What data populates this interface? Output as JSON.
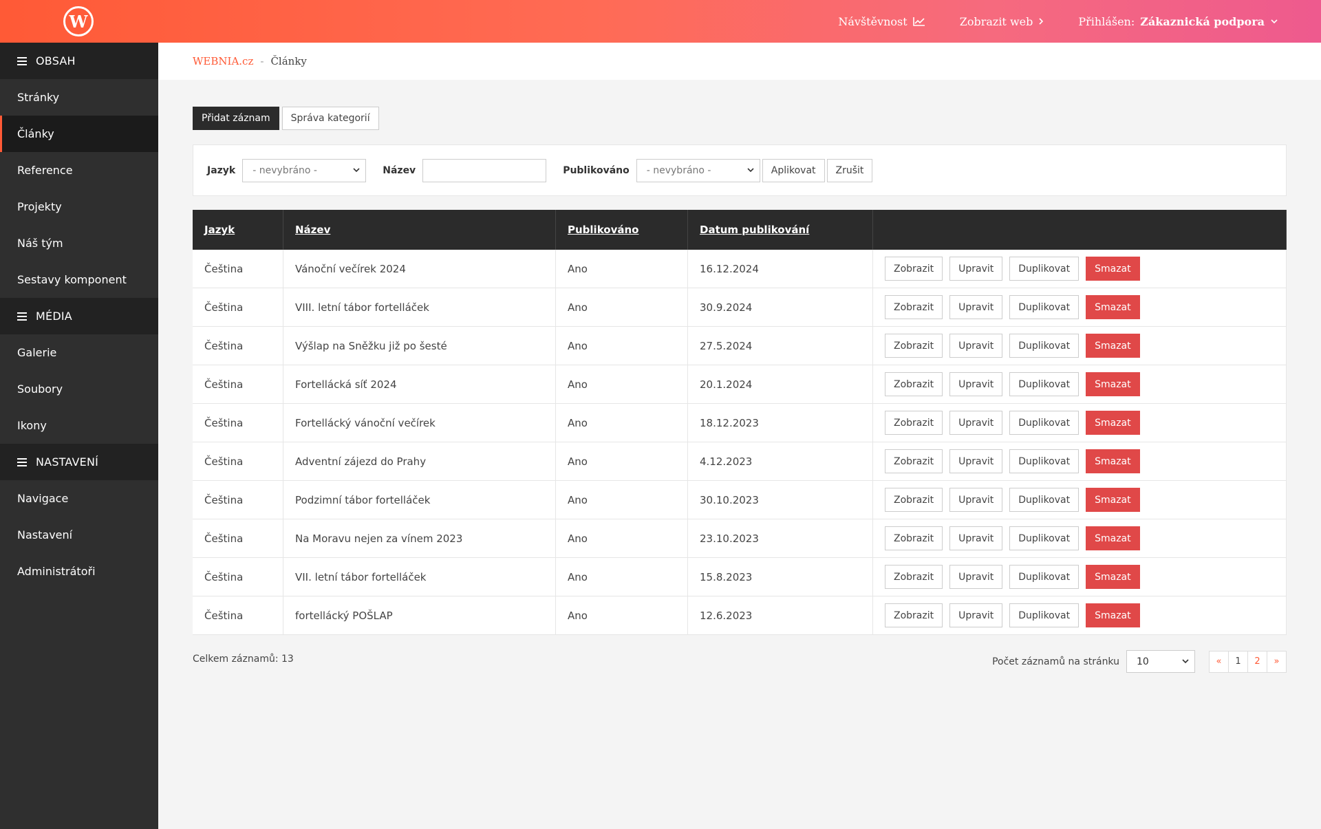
{
  "header": {
    "logo_letter": "W",
    "nav": [
      {
        "label": "Návštěvnost"
      },
      {
        "label": "Zobrazit web"
      }
    ],
    "user_prefix": "Přihlášen:",
    "user_name": "Zákaznická podpora"
  },
  "sidebar": {
    "sections": [
      {
        "title": "OBSAH",
        "items": [
          "Stránky",
          "Články",
          "Reference",
          "Projekty",
          "Náš tým",
          "Sestavy komponent"
        ]
      },
      {
        "title": "MÉDIA",
        "items": [
          "Galerie",
          "Soubory",
          "Ikony"
        ]
      },
      {
        "title": "NASTAVENÍ",
        "items": [
          "Navigace",
          "Nastavení",
          "Administrátoři"
        ]
      }
    ],
    "active_item": "Články"
  },
  "breadcrumb": {
    "root": "WEBNIA.cz",
    "separator": "-",
    "current": "Články"
  },
  "actions": {
    "add": "Přidat záznam",
    "categories": "Správa kategorií"
  },
  "filter": {
    "language_label": "Jazyk",
    "language_value": "- nevybráno -",
    "name_label": "Název",
    "name_value": "",
    "published_label": "Publikováno",
    "published_value": "- nevybráno -",
    "apply": "Aplikovat",
    "cancel": "Zrušit"
  },
  "table": {
    "columns": [
      "Jazyk",
      "Název",
      "Publikováno",
      "Datum publikování"
    ],
    "row_actions": {
      "view": "Zobrazit",
      "edit": "Upravit",
      "duplicate": "Duplikovat",
      "delete": "Smazat"
    },
    "rows": [
      {
        "lang": "Čeština",
        "name": "Vánoční večírek 2024",
        "published": "Ano",
        "date": "16.12.2024"
      },
      {
        "lang": "Čeština",
        "name": "VIII. letní tábor fortelláček",
        "published": "Ano",
        "date": "30.9.2024"
      },
      {
        "lang": "Čeština",
        "name": "Výšlap na Sněžku již po šesté",
        "published": "Ano",
        "date": "27.5.2024"
      },
      {
        "lang": "Čeština",
        "name": "Fortellácká síť 2024",
        "published": "Ano",
        "date": "20.1.2024"
      },
      {
        "lang": "Čeština",
        "name": "Fortellácký vánoční večírek",
        "published": "Ano",
        "date": "18.12.2023"
      },
      {
        "lang": "Čeština",
        "name": "Adventní zájezd do Prahy",
        "published": "Ano",
        "date": "4.12.2023"
      },
      {
        "lang": "Čeština",
        "name": "Podzimní tábor fortelláček",
        "published": "Ano",
        "date": "30.10.2023"
      },
      {
        "lang": "Čeština",
        "name": "Na Moravu nejen za vínem 2023",
        "published": "Ano",
        "date": "23.10.2023"
      },
      {
        "lang": "Čeština",
        "name": "VII. letní tábor fortelláček",
        "published": "Ano",
        "date": "15.8.2023"
      },
      {
        "lang": "Čeština",
        "name": "fortellácký POŠLAP",
        "published": "Ano",
        "date": "12.6.2023"
      }
    ]
  },
  "footer": {
    "total": "Celkem záznamů: 13",
    "per_page_label": "Počet záznamů na stránku",
    "per_page_value": "10",
    "pager": [
      "«",
      "1",
      "2",
      "»"
    ]
  },
  "colors": {
    "accent": "#ff5a36",
    "danger": "#e04848",
    "dark": "#2b2b2b"
  }
}
